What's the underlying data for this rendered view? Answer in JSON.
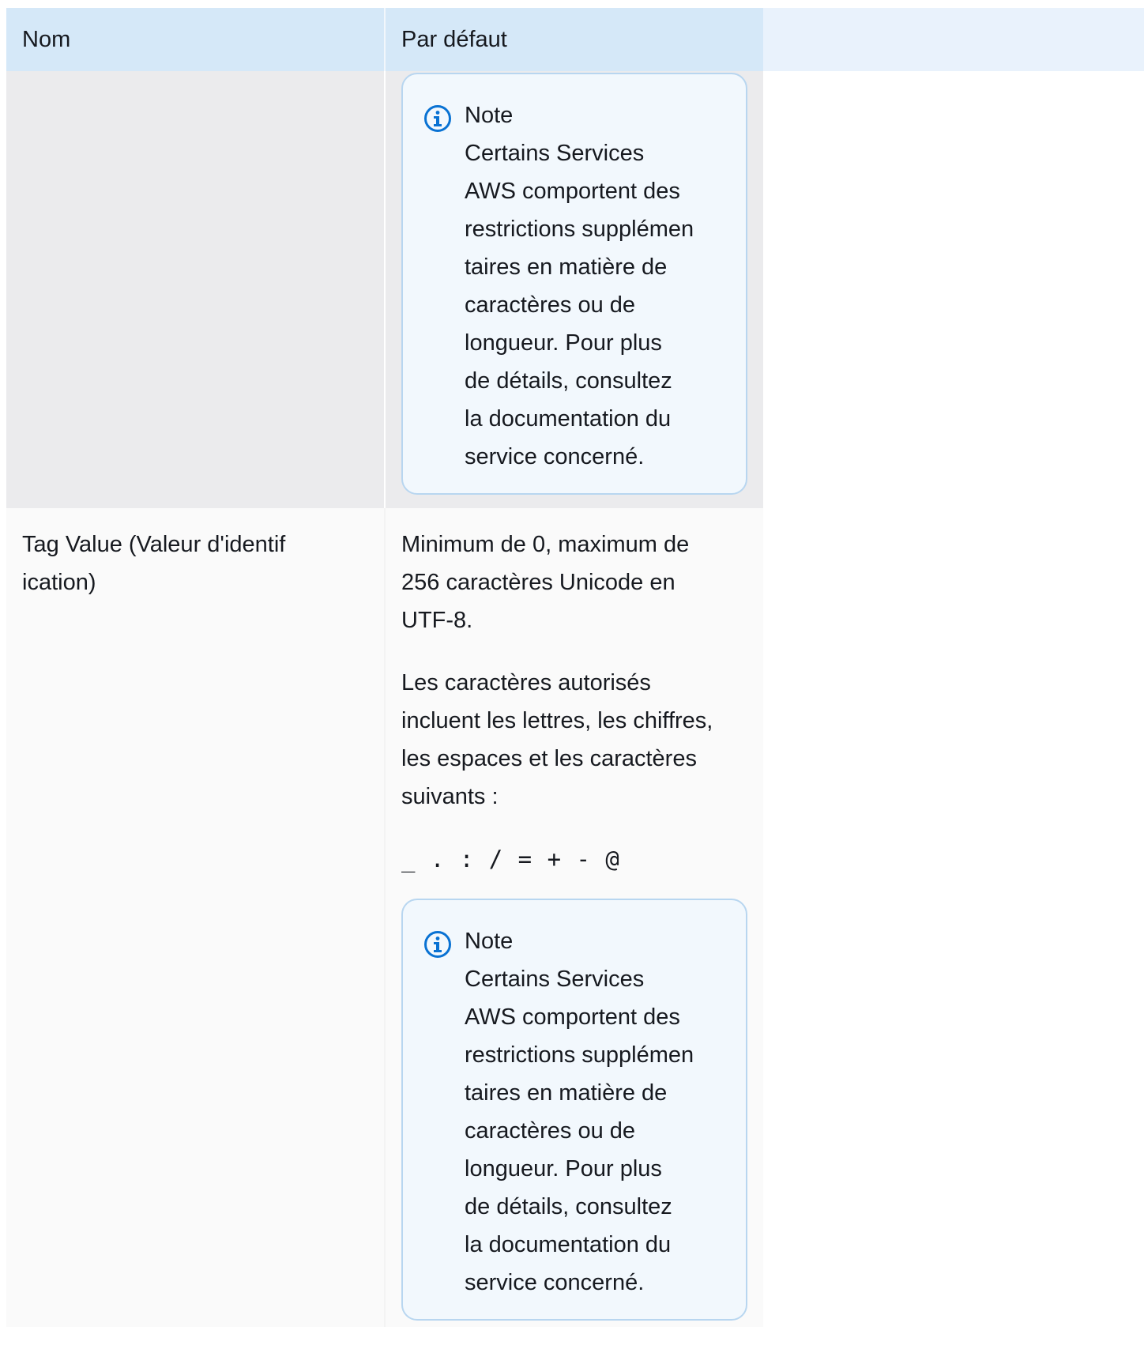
{
  "table": {
    "headers": [
      "Nom",
      "Par défaut"
    ],
    "rows": [
      {
        "name": "",
        "note": {
          "title": "Note",
          "lines": [
            "Certains Services",
            "AWS comportent des",
            "restrictions supplémen",
            "taires en matière de",
            "caractères ou de",
            "longueur. Pour plus",
            "de détails, consultez",
            "la documentation du",
            "service concerné."
          ]
        }
      },
      {
        "name_lines": [
          "Tag Value (Valeur d'identif",
          "ication)"
        ],
        "default_lines_1": [
          "Minimum de 0, maximum de",
          "256 caractères Unicode en",
          "UTF-8."
        ],
        "default_lines_2": [
          "Les caractères autorisés",
          "incluent les lettres, les chiffres,",
          "les espaces et les caractères",
          "suivants :"
        ],
        "allowed_chars": "_ . : / = + - @",
        "note": {
          "title": "Note",
          "lines": [
            "Certains Services",
            "AWS comportent des",
            "restrictions supplémen",
            "taires en matière de",
            "caractères ou de",
            "longueur. Pour plus",
            "de détails, consultez",
            "la documentation du",
            "service concerné."
          ]
        }
      }
    ]
  },
  "icons": {
    "note_icon": "info-circle-icon",
    "note_icon_color": "#0972d3"
  }
}
